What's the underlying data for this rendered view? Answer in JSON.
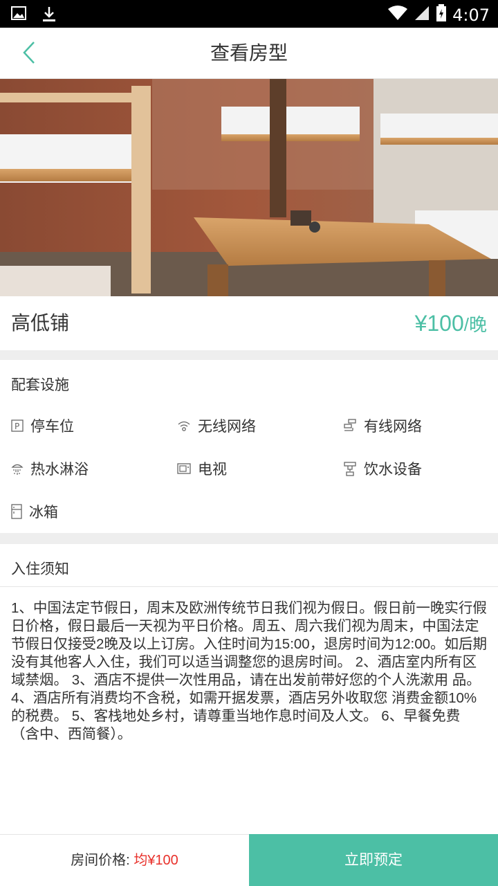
{
  "status_bar": {
    "time": "4:07"
  },
  "header": {
    "title": "查看房型",
    "back_icon": "chevron-left-icon"
  },
  "room": {
    "name": "高低铺",
    "price": "¥100",
    "price_unit": "/晚"
  },
  "facilities": {
    "title": "配套设施",
    "items": [
      {
        "label": "停车位",
        "icon": "parking-icon"
      },
      {
        "label": "无线网络",
        "icon": "wifi-icon"
      },
      {
        "label": "有线网络",
        "icon": "wired-network-icon"
      },
      {
        "label": "热水淋浴",
        "icon": "shower-icon"
      },
      {
        "label": "电视",
        "icon": "tv-icon"
      },
      {
        "label": "饮水设备",
        "icon": "water-dispenser-icon"
      },
      {
        "label": "冰箱",
        "icon": "fridge-icon"
      }
    ]
  },
  "notice": {
    "title": "入住须知",
    "text": "1、中国法定节假日，周末及欧洲传统节日我们视为假日。假日前一晚实行假日价格，假日最后一天视为平日价格。周五、周六我们视为周末，中国法定节假日仅接受2晚及以上订房。入住时间为15:00，退房时间为12:00。如后期没有其他客人入住，我们可以适当调整您的退房时间。 2、酒店室内所有区域禁烟。 3、酒店不提供一次性用品，请在出发前带好您的个人洗漱用 品。 4、酒店所有消费均不含税，如需开据发票，酒店另外收取您    消费金额10%的税费。 5、客栈地处乡村，请尊重当地作息时间及人文。 6、早餐免费（含中、西简餐）。"
  },
  "bottom": {
    "price_label": "房间价格: ",
    "price_value": "均¥100",
    "book_label": "立即预定"
  },
  "colors": {
    "accent": "#4cbfa5",
    "price_red": "#e8302a"
  }
}
